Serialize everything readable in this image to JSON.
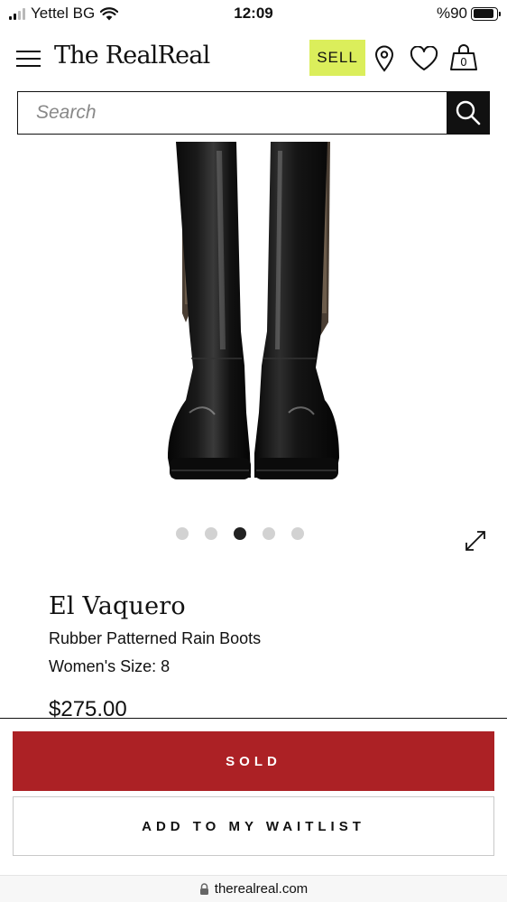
{
  "status_bar": {
    "carrier": "Yettel BG",
    "time": "12:09",
    "battery": "%90"
  },
  "header": {
    "logo": "The RealReal",
    "sell_label": "SELL",
    "bag_count": "0",
    "icons": [
      "menu-icon",
      "location-pin-icon",
      "heart-icon",
      "shopping-bag-icon"
    ]
  },
  "search": {
    "placeholder": "Search",
    "value": ""
  },
  "carousel": {
    "total": 5,
    "active_index": 2
  },
  "product": {
    "brand": "El Vaquero",
    "name": "Rubber Patterned Rain Boots",
    "size": "Women's Size: 8",
    "price": "$275.00"
  },
  "actions": {
    "sold_label": "SOLD",
    "waitlist_label": "ADD TO MY WAITLIST"
  },
  "browser": {
    "url": "therealreal.com"
  },
  "colors": {
    "sell_accent": "#dbee5b",
    "sold_red": "#ac2125"
  }
}
